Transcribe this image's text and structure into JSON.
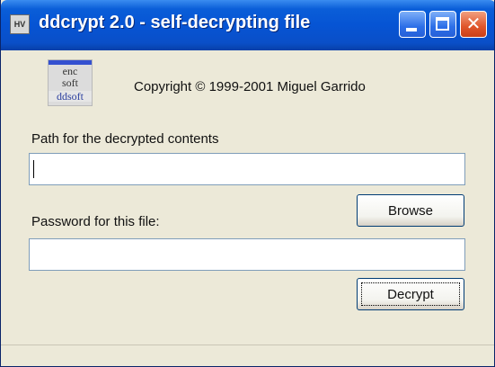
{
  "window": {
    "title": "ddcrypt 2.0 - self-decrypting file",
    "app_icon_glyph": "HV",
    "controls": {
      "minimize_icon": "minimize-icon",
      "maximize_icon": "maximize-icon",
      "close_icon": "close-icon",
      "close_glyph": "✕"
    }
  },
  "header": {
    "logo_lines": [
      "enc",
      "soft",
      "ddsoft"
    ],
    "copyright": "Copyright © 1999-2001 Miguel Garrido"
  },
  "form": {
    "path_label": "Path for the decrypted contents",
    "path_value": "",
    "browse_label": "Browse",
    "password_label": "Password for this file:",
    "password_value": "",
    "decrypt_label": "Decrypt"
  },
  "colors": {
    "titlebar": "#0654d4",
    "dialog_bg": "#ece9d8",
    "button_border": "#003c74",
    "field_border": "#7f9db9"
  }
}
